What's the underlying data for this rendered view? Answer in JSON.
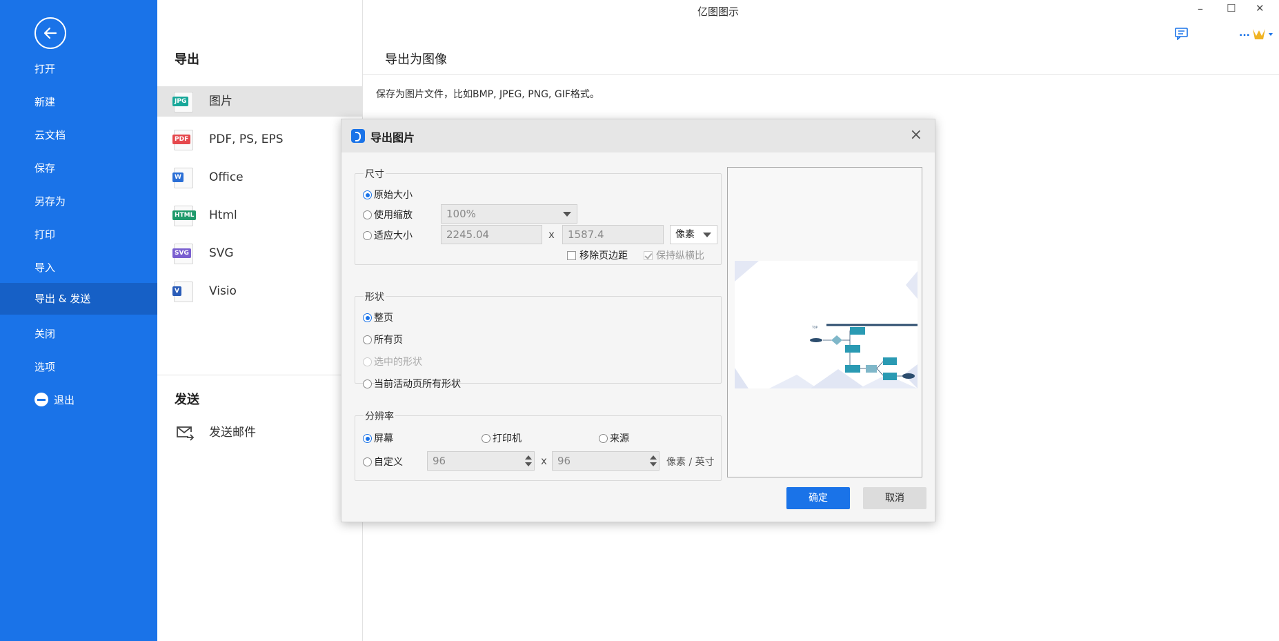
{
  "window": {
    "title": "亿图图示",
    "min": "–",
    "max": "☐",
    "close": "✕"
  },
  "toolbar": {
    "chat_icon": "chat-icon",
    "more": "...",
    "premium_icon": "crown-icon"
  },
  "sidebar": {
    "items": [
      {
        "label": "打开"
      },
      {
        "label": "新建"
      },
      {
        "label": "云文档"
      },
      {
        "label": "保存"
      },
      {
        "label": "另存为"
      },
      {
        "label": "打印"
      },
      {
        "label": "导入"
      },
      {
        "label": "导出 & 发送"
      },
      {
        "label": "关闭"
      },
      {
        "label": "选项"
      }
    ],
    "exit": "退出"
  },
  "export_section": {
    "title": "导出",
    "formats": [
      {
        "label": "图片",
        "tag": "JPG",
        "color": "#19a89a"
      },
      {
        "label": "PDF, PS, EPS",
        "tag": "PDF",
        "color": "#e5484d"
      },
      {
        "label": "Office",
        "tag": "W",
        "color": "#2b6fd6"
      },
      {
        "label": "Html",
        "tag": "HTML",
        "color": "#1f9a6c"
      },
      {
        "label": "SVG",
        "tag": "SVG",
        "color": "#7a5fd0"
      },
      {
        "label": "Visio",
        "tag": "V",
        "color": "#2a5cb8"
      }
    ]
  },
  "send_section": {
    "title": "发送",
    "email": "发送邮件"
  },
  "right": {
    "title": "导出为图像",
    "desc": "保存为图片文件，比如BMP, JPEG, PNG, GIF格式。"
  },
  "dialog": {
    "title": "导出图片",
    "close": "×",
    "size": {
      "legend": "尺寸",
      "original": "原始大小",
      "scale": "使用缩放",
      "scale_value": "100%",
      "fit": "适应大小",
      "width": "2245.04",
      "height": "1587.4",
      "x": "x",
      "unit": "像素",
      "remove_margin": "移除页边距",
      "keep_ratio": "保持纵横比"
    },
    "shape": {
      "legend": "形状",
      "whole_page": "整页",
      "all_pages": "所有页",
      "selected": "选中的形状",
      "current_all": "当前活动页所有形状"
    },
    "resolution": {
      "legend": "分辨率",
      "screen": "屏幕",
      "printer": "打印机",
      "source": "来源",
      "custom": "自定义",
      "dpi_x": "96",
      "dpi_y": "96",
      "x": "x",
      "unit": "像素 / 英寸"
    },
    "ok": "确定",
    "cancel": "取消"
  },
  "colors": {
    "accent": "#1a73e8",
    "sidebar_active": "#1660c6"
  }
}
